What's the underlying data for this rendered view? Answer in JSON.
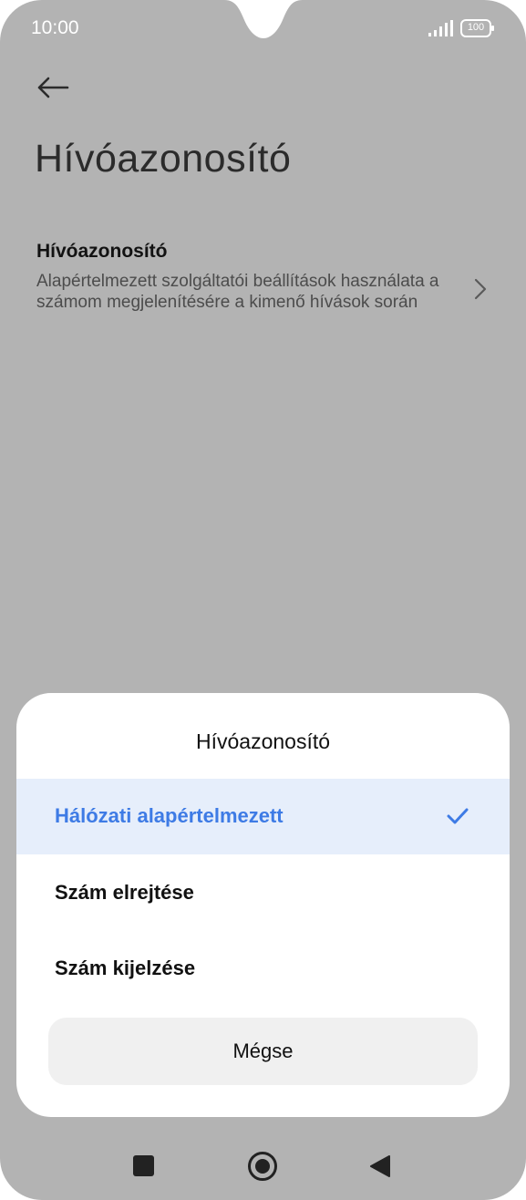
{
  "status_bar": {
    "time": "10:00",
    "battery": "100",
    "icons": [
      "signal-icon",
      "battery-icon"
    ]
  },
  "header": {
    "back_icon": "back-arrow-icon",
    "title": "Hívóazonosító"
  },
  "setting": {
    "title": "Hívóazonosító",
    "summary": "Alapértelmezett szolgáltatói beállítások használata a számom megjelenítésére a kimenő hívások során",
    "icon": "chevron-right-icon"
  },
  "dialog": {
    "title": "Hívóazonosító",
    "options": [
      {
        "label": "Hálózati alapértelmezett",
        "selected": true
      },
      {
        "label": "Szám elrejtése",
        "selected": false
      },
      {
        "label": "Szám kijelzése",
        "selected": false
      }
    ],
    "cancel_label": "Mégse",
    "check_icon": "check-icon"
  },
  "nav_bar": {
    "icons": [
      "recent-apps-icon",
      "home-icon",
      "back-icon"
    ]
  },
  "colors": {
    "scrim": "#b3b3b3",
    "accent": "#3e7be5",
    "selected_row": "#e6eefb",
    "sheet": "#ffffff"
  }
}
